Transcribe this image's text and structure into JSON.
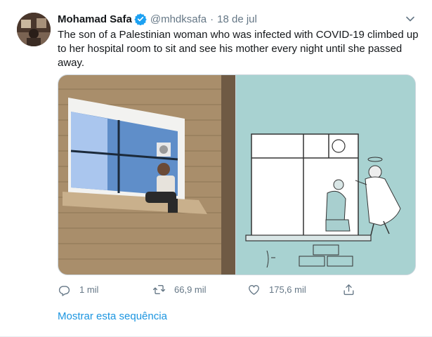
{
  "tweet": {
    "author_name": "Mohamad Safa",
    "handle": "@mhdksafa",
    "separator": "·",
    "date": "18 de jul",
    "text": "The son of a Palestinian woman who was infected with COVID-19 climbed up to her hospital room to sit and see his mother every night until she passed away.",
    "verified": true
  },
  "icons": {
    "avatar": "avatar-photo",
    "verified": "verified-badge-icon",
    "more": "chevron-down-icon",
    "reply": "reply-icon",
    "retweet": "retweet-icon",
    "like": "heart-icon",
    "share": "share-icon"
  },
  "actions": {
    "replies": "1 mil",
    "retweets": "66,9 mil",
    "likes": "175,6 mil"
  },
  "show_thread_label": "Mostrar esta sequência",
  "colors": {
    "text": "#14171a",
    "secondary": "#657786",
    "link": "#1b95e0",
    "verified": "#1da1f2",
    "cartoon_bg": "#a8d2d1"
  }
}
